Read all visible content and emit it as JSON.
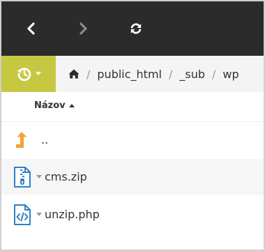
{
  "toolbar": {
    "back_icon": "chevron-left-icon",
    "forward_icon": "chevron-right-icon",
    "refresh_icon": "refresh-icon",
    "history_icon": "history-icon",
    "history_bg": "#c6c842",
    "bar_color": "#2b2b2b"
  },
  "breadcrumb": {
    "home_icon": "home-icon",
    "items": [
      "public_html",
      "_sub",
      "wp"
    ],
    "separator": "/"
  },
  "list": {
    "column_name": "Názov",
    "sort": "ascending",
    "rows": [
      {
        "name": "..",
        "icon": "parent-folder-icon"
      },
      {
        "name": "cms.zip",
        "icon": "zip-file-icon"
      },
      {
        "name": "unzip.php",
        "icon": "code-file-icon"
      }
    ]
  },
  "colors": {
    "file_icon_blue": "#2f7fc8",
    "parent_icon_orange": "#f2a33a"
  }
}
